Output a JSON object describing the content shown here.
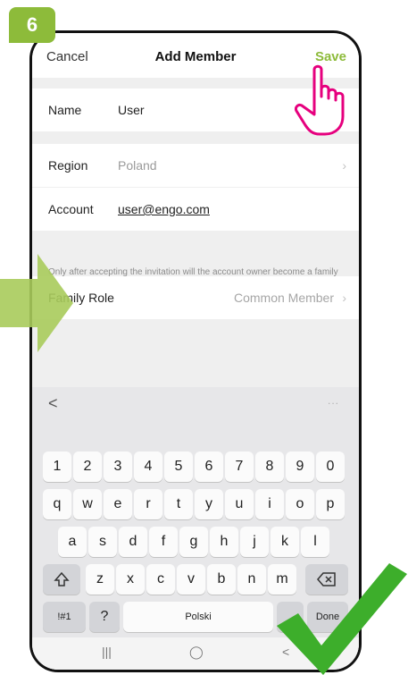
{
  "step": "6",
  "nav": {
    "cancel": "Cancel",
    "title": "Add Member",
    "save": "Save"
  },
  "form": {
    "name_label": "Name",
    "name_value": "User",
    "region_label": "Region",
    "region_value": "Poland",
    "account_label": "Account",
    "account_value": "user@engo.com",
    "note": "Only after accepting the invitation will the account owner become a family member and be able to use relevant functions.",
    "role_label": "Family Role",
    "role_value": "Common Member"
  },
  "keyboard": {
    "top_back": "<",
    "top_more": "...",
    "row_numbers": [
      "1",
      "2",
      "3",
      "4",
      "5",
      "6",
      "7",
      "8",
      "9",
      "0"
    ],
    "row_1": [
      "q",
      "w",
      "e",
      "r",
      "t",
      "y",
      "u",
      "i",
      "o",
      "p"
    ],
    "row_2": [
      "a",
      "s",
      "d",
      "f",
      "g",
      "h",
      "j",
      "k",
      "l"
    ],
    "row_3": [
      "z",
      "x",
      "c",
      "v",
      "b",
      "n",
      "m"
    ],
    "symbols": "!#1",
    "question": "?",
    "space_label": "Polski",
    "period": ".",
    "done": "Done"
  },
  "system_nav": {
    "recent": "|||",
    "home": "◯",
    "back": "<"
  },
  "colors": {
    "accent": "#8dbb3a",
    "pointer_hand": "#e6007e",
    "check": "#3dae2b"
  },
  "icons": [
    "pointer-hand-icon",
    "arrow-right-icon",
    "checkmark-icon",
    "chevron-right-icon",
    "shift-icon",
    "backspace-icon"
  ]
}
